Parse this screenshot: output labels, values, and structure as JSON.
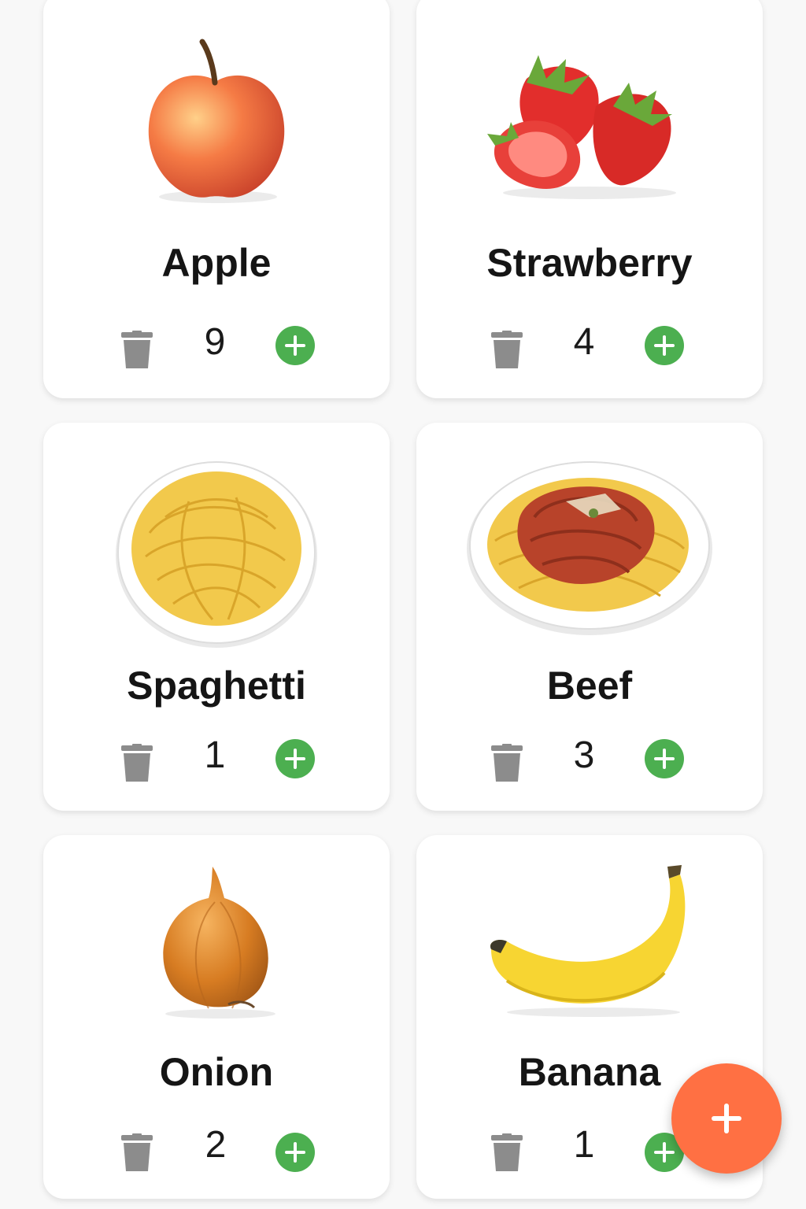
{
  "colors": {
    "background": "#f8f8f8",
    "card": "#ffffff",
    "trash_icon": "#8c8c8c",
    "add_button": "#4caf50",
    "fab": "#ff7043"
  },
  "items": [
    {
      "name": "Apple",
      "quantity": "9",
      "image_icon": "apple-icon"
    },
    {
      "name": "Strawberry",
      "quantity": "4",
      "image_icon": "strawberry-icon"
    },
    {
      "name": "Spaghetti",
      "quantity": "1",
      "image_icon": "spaghetti-icon"
    },
    {
      "name": "Beef",
      "quantity": "3",
      "image_icon": "beef-icon"
    },
    {
      "name": "Onion",
      "quantity": "2",
      "image_icon": "onion-icon"
    },
    {
      "name": "Banana",
      "quantity": "1",
      "image_icon": "banana-icon"
    }
  ],
  "fab": {
    "icon": "plus-icon"
  }
}
